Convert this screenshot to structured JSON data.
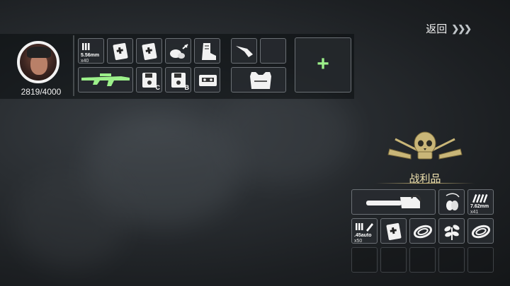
{
  "header": {
    "back_label": "返回",
    "back_arrows": "❯❯❯"
  },
  "player": {
    "xp_text": "2819/4000"
  },
  "inventory": {
    "ammo_556": {
      "caliber": "5.56mm",
      "count": "x40"
    },
    "disk_c_label": "C",
    "disk_b_label": "B"
  },
  "add_slot": {
    "symbol": "+"
  },
  "loot": {
    "title": "战利品",
    "ammo_762": {
      "caliber": "7.62mm",
      "count": "x41"
    },
    "ammo_45": {
      "caliber": ".45auto",
      "count": "x50"
    }
  },
  "colors": {
    "accent_green": "#9cf08a",
    "emblem_gold": "#c9b678"
  }
}
